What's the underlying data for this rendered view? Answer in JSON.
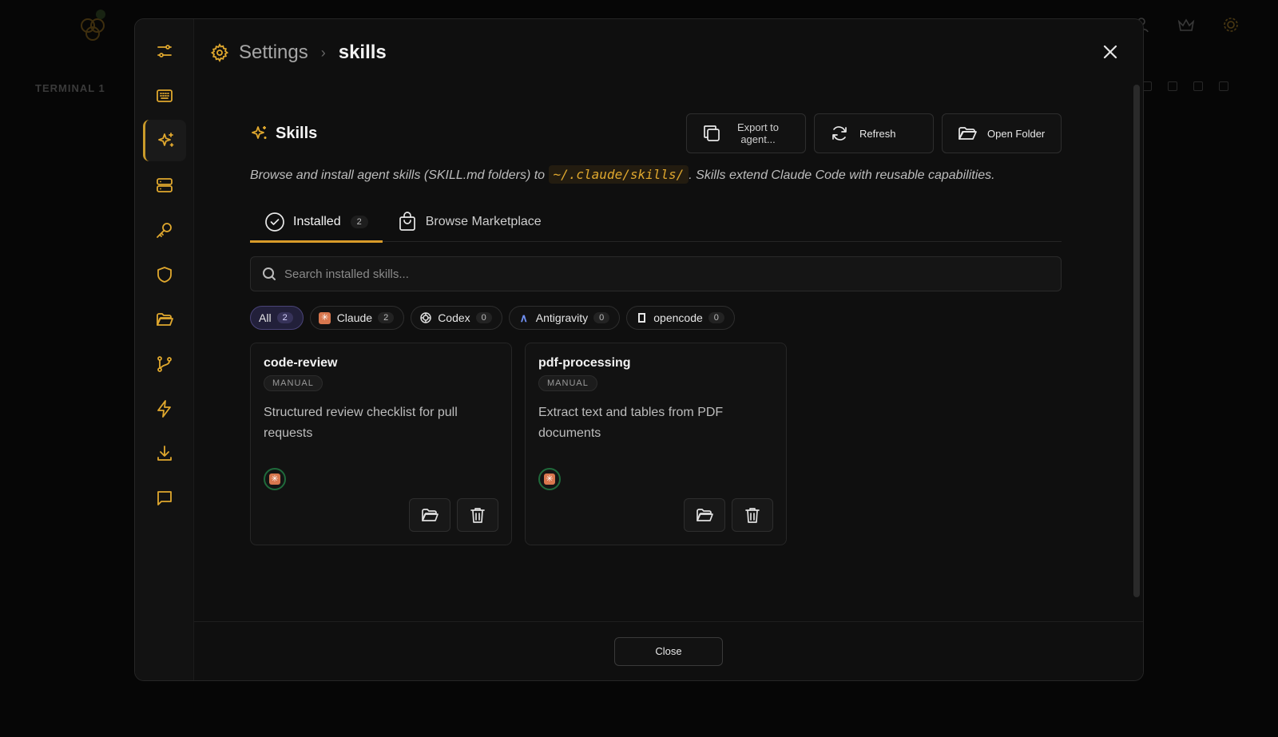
{
  "background": {
    "terminal_tab": "TERMINAL 1"
  },
  "header": {
    "settings_label": "Settings",
    "separator": "›",
    "current": "skills"
  },
  "rail": {
    "items": [
      {
        "icon": "sliders-icon",
        "active": false
      },
      {
        "icon": "keyboard-icon",
        "active": false
      },
      {
        "icon": "sparkles-icon",
        "active": true
      },
      {
        "icon": "server-icon",
        "active": false
      },
      {
        "icon": "key-icon",
        "active": false
      },
      {
        "icon": "shield-icon",
        "active": false
      },
      {
        "icon": "folder-icon",
        "active": false
      },
      {
        "icon": "git-branch-icon",
        "active": false
      },
      {
        "icon": "lightning-icon",
        "active": false
      },
      {
        "icon": "download-icon",
        "active": false
      },
      {
        "icon": "chat-icon",
        "active": false
      }
    ]
  },
  "section": {
    "title": "Skills",
    "export_label": "Export to agent...",
    "refresh_label": "Refresh",
    "open_folder_label": "Open Folder",
    "desc_before": "Browse and install agent skills (SKILL.md folders) to ",
    "desc_path": "~/.claude/skills/",
    "desc_after": ". Skills extend Claude Code with reusable capabilities."
  },
  "tabs": {
    "installed_label": "Installed",
    "installed_count": "2",
    "marketplace_label": "Browse Marketplace"
  },
  "search": {
    "placeholder": "Search installed skills...",
    "value": ""
  },
  "filters": [
    {
      "label": "All",
      "count": "2",
      "active": true
    },
    {
      "label": "Claude",
      "count": "2",
      "active": false
    },
    {
      "label": "Codex",
      "count": "0",
      "active": false
    },
    {
      "label": "Antigravity",
      "count": "0",
      "active": false
    },
    {
      "label": "opencode",
      "count": "0",
      "active": false
    }
  ],
  "skills": [
    {
      "name": "code-review",
      "tag": "MANUAL",
      "description": "Structured review checklist for pull requests"
    },
    {
      "name": "pdf-processing",
      "tag": "MANUAL",
      "description": "Extract text and tables from PDF documents"
    }
  ],
  "footer": {
    "close_label": "Close"
  },
  "colors": {
    "accent": "#e0a82e",
    "active_chip": "#22203a",
    "claude": "#d8774e"
  }
}
